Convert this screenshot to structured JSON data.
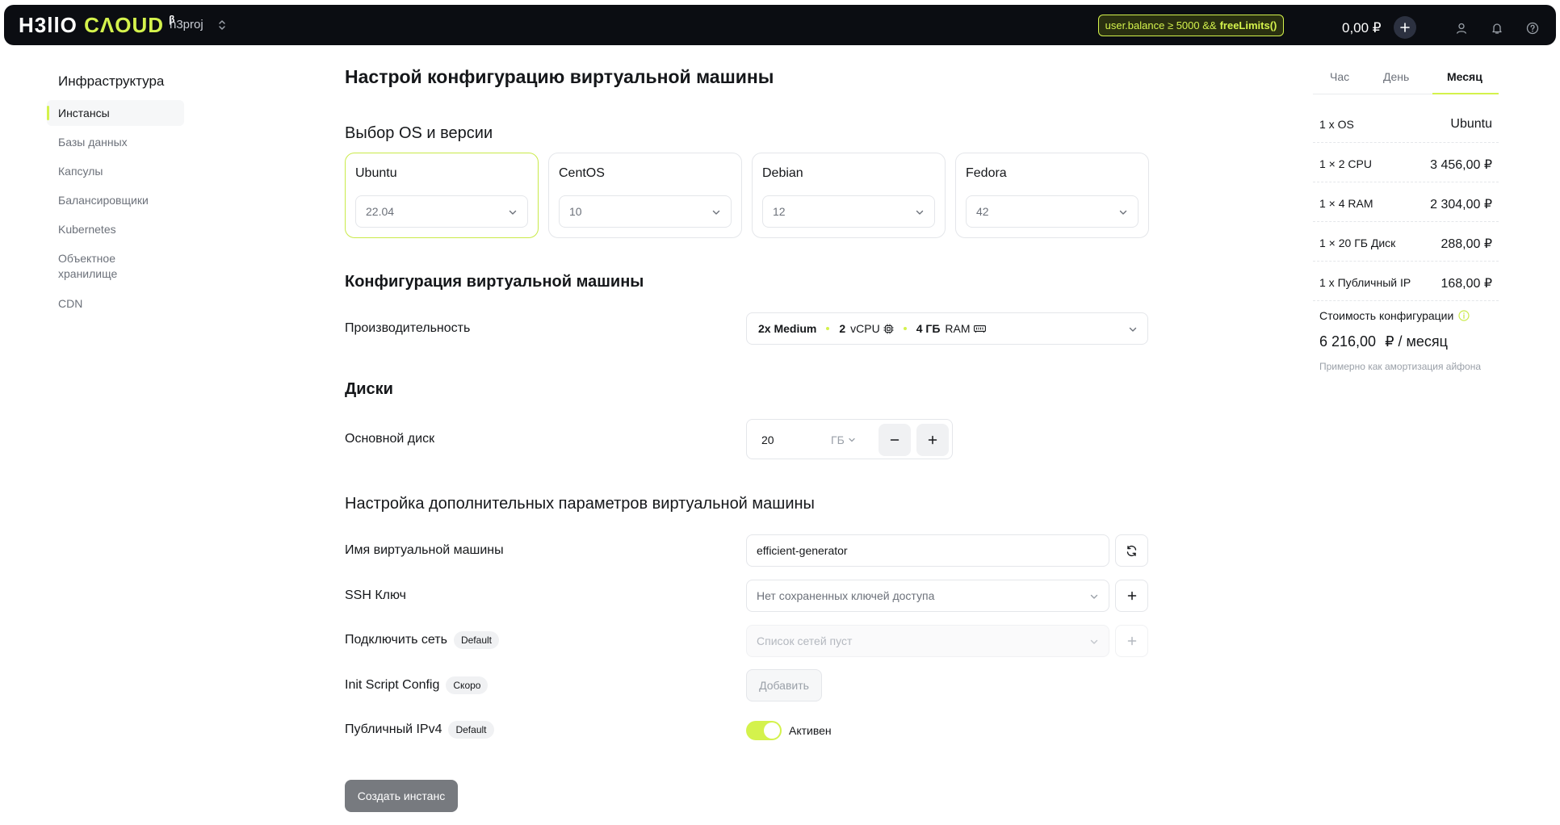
{
  "header": {
    "logo_main": "H3llO",
    "logo_accent": "CΛOUD",
    "logo_beta": "β",
    "project": "h3proj",
    "badge_code": "user.balance ≥ 5000 &&",
    "badge_fn": "freeLimits()",
    "balance": "0,00 ₽",
    "colors": {
      "accent": "#d4f24c",
      "bar": "#0b0d12"
    },
    "icons": [
      "chevron-updown-icon",
      "plus-icon",
      "user-icon",
      "bell-icon",
      "help-icon"
    ]
  },
  "sidebar": {
    "title": "Инфраструктура",
    "items": [
      {
        "label": "Инстансы"
      },
      {
        "label": "Базы данных"
      },
      {
        "label": "Капсулы"
      },
      {
        "label": "Балансировщики"
      },
      {
        "label": "Kubernetes"
      },
      {
        "label": "Объектное"
      },
      {
        "label": "хранилище"
      },
      {
        "label": "CDN"
      }
    ]
  },
  "main": {
    "title": "Настрой конфигурацию виртуальной машины",
    "os_section": "Выбор OS и версии",
    "os_cards": [
      {
        "name": "Ubuntu",
        "version": "22.04"
      },
      {
        "name": "CentOS",
        "version": "10"
      },
      {
        "name": "Debian",
        "version": "12"
      },
      {
        "name": "Fedora",
        "version": "42"
      }
    ],
    "config_section": "Конфигурация виртуальной машины",
    "performance_label": "Производительность",
    "performance": {
      "preset": "2x Medium",
      "cpu_count": "2",
      "cpu_unit": "vCPU",
      "ram_amount": "4 ГБ",
      "ram_unit": "RAM"
    },
    "disks_section": "Диски",
    "disk_label": "Основной диск",
    "disk_value": "20",
    "disk_unit": "ГБ",
    "advanced_section": "Настройка дополнительных параметров виртуальной машины",
    "vm_name_label": "Имя виртуальной машины",
    "vm_name_value": "efficient-generator",
    "ssh_label": "SSH Ключ",
    "ssh_placeholder": "Нет сохраненных ключей доступа",
    "network_label": "Подключить сеть",
    "network_badge": "Default",
    "network_placeholder": "Список сетей пуст",
    "init_label": "Init Script Config",
    "init_badge": "Скоро",
    "init_button": "Добавить",
    "ipv4_label": "Публичный IPv4",
    "ipv4_badge": "Default",
    "ipv4_enabled": true,
    "ipv4_state": "Активен",
    "create_button": "Создать инстанс"
  },
  "summary": {
    "tabs": [
      {
        "label": "Час"
      },
      {
        "label": "День"
      },
      {
        "label": "Месяц"
      }
    ],
    "active_tab": "Месяц",
    "rows": [
      {
        "label": "1 x OS",
        "value": "Ubuntu"
      },
      {
        "label": "1 × 2 CPU",
        "value": "3 456,00 ₽"
      },
      {
        "label": "1 × 4 RAM",
        "value": "2 304,00 ₽"
      },
      {
        "label": "1 × 20 ГБ Диск",
        "value": "288,00 ₽"
      },
      {
        "label": "1 x Публичный IP",
        "value": "168,00 ₽"
      }
    ],
    "total_label": "Стоимость конфигурации",
    "total_value": "6 216,00",
    "total_unit": "₽ / месяц",
    "note": "Примерно как амортизация айфона"
  }
}
